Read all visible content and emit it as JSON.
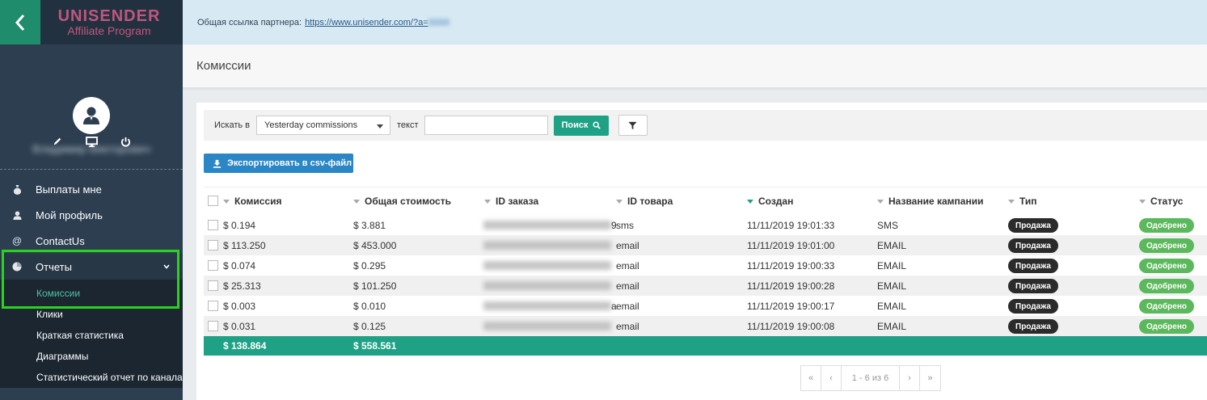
{
  "sidebar": {
    "logo_main": "UNISENDER",
    "logo_sub": "Affiliate Program",
    "username": "Владимир Викторович",
    "menu": [
      {
        "label": "Выплаты мне",
        "icon": "money-bag-icon"
      },
      {
        "label": "Мой профиль",
        "icon": "user-icon"
      },
      {
        "label": "ContactUs",
        "icon": "at-icon"
      },
      {
        "label": "Отчеты",
        "icon": "pie-chart-icon"
      }
    ],
    "submenu": [
      {
        "label": "Комиссии",
        "active": true
      },
      {
        "label": "Клики"
      },
      {
        "label": "Краткая статистика"
      },
      {
        "label": "Диаграммы"
      },
      {
        "label": "Статистический отчет по каналам"
      }
    ]
  },
  "partner": {
    "label": "Общая ссылка партнера:",
    "link": "https://www.unisender.com/?a="
  },
  "page_title": "Комиссии",
  "search": {
    "label": "Искать в",
    "select_value": "Yesterday commissions",
    "text_label": "текст",
    "button": "Поиск"
  },
  "export_label": "Экспортировать в csv-файл",
  "table": {
    "headers": [
      "Комиссия",
      "Общая стоимость",
      "ID заказа",
      "ID товара",
      "Создан",
      "Название кампании",
      "Тип",
      "Статус"
    ],
    "rows": [
      {
        "commission": "$ 0.194",
        "total": "$ 3.881",
        "product": "sms",
        "product_prefix": "9",
        "created": "11/11/2019 19:01:33",
        "campaign": "SMS",
        "type": "Продажа",
        "status": "Одобрено"
      },
      {
        "commission": "$ 113.250",
        "total": "$ 453.000",
        "product": "email",
        "product_prefix": "",
        "created": "11/11/2019 19:01:00",
        "campaign": "EMAIL",
        "type": "Продажа",
        "status": "Одобрено"
      },
      {
        "commission": "$ 0.074",
        "total": "$ 0.295",
        "product": "email",
        "product_prefix": "",
        "created": "11/11/2019 19:00:33",
        "campaign": "EMAIL",
        "type": "Продажа",
        "status": "Одобрено"
      },
      {
        "commission": "$ 25.313",
        "total": "$ 101.250",
        "product": "email",
        "product_prefix": "",
        "created": "11/11/2019 19:00:28",
        "campaign": "EMAIL",
        "type": "Продажа",
        "status": "Одобрено"
      },
      {
        "commission": "$ 0.003",
        "total": "$ 0.010",
        "product": "email",
        "product_prefix": "a",
        "created": "11/11/2019 19:00:17",
        "campaign": "EMAIL",
        "type": "Продажа",
        "status": "Одобрено"
      },
      {
        "commission": "$ 0.031",
        "total": "$ 0.125",
        "product": "email",
        "product_prefix": "",
        "created": "11/11/2019 19:00:08",
        "campaign": "EMAIL",
        "type": "Продажа",
        "status": "Одобрено"
      }
    ],
    "total_commission": "$ 138.864",
    "total_amount": "$ 558.561"
  },
  "pager": {
    "first": "«",
    "prev": "‹",
    "info": "1 - 6 из 6",
    "next": "›",
    "last": "»"
  },
  "colors": {
    "sidebar_bg": "#2c3e50",
    "accent": "#1ea185",
    "export_blue": "#2a86c5",
    "approved_green": "#5cb85c",
    "highlight": "#29d31e",
    "brand_pink": "#c0567f"
  }
}
